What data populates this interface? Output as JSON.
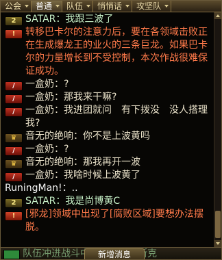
{
  "tabs": [
    {
      "label": "公会",
      "active": false
    },
    {
      "label": "普通",
      "active": true
    },
    {
      "label": "队伍",
      "active": false
    },
    {
      "label": "悄悄话",
      "active": false
    },
    {
      "label": "攻坚队",
      "active": false
    }
  ],
  "messages": [
    {
      "channel": "team",
      "badge": "2",
      "text": "SATAR：我跟三波了"
    },
    {
      "channel": "system",
      "badge": "!",
      "text": "转移巴卡尔的注意力后，要在各领域击败正在生成爆龙王的业火的三条巨龙。如果巴卡尔的力量增长到不受控制，本次作战很难保证成功。"
    },
    {
      "channel": "world",
      "badge": "/",
      "text": "一盒奶：?"
    },
    {
      "channel": "world",
      "badge": "/",
      "text": "一盒奶：那我来干嘛?"
    },
    {
      "channel": "world",
      "badge": "/",
      "text": "一盒奶：我进团就问　有下拨没　没人搭理我?"
    },
    {
      "channel": "crown",
      "badge": "♛",
      "text": "音无的绝响：你不是上波黄吗"
    },
    {
      "channel": "world",
      "badge": "/",
      "text": "一盒奶：?"
    },
    {
      "channel": "crown",
      "badge": "♛",
      "text": "音无的绝响：那我再开一波"
    },
    {
      "channel": "world",
      "badge": "/",
      "text": "一盒奶：我啥时候上波黄了"
    },
    {
      "channel": "local",
      "badge": "",
      "text": "RuningMan!：.."
    },
    {
      "channel": "team",
      "badge": "2",
      "text": "SATAR：我是尚博黄C"
    },
    {
      "channel": "system",
      "badge": "!",
      "text": "[邪龙]领域中出现了[腐败区域]要想办法摆脱。"
    }
  ],
  "bottom": {
    "preview_text": "队伍冲进战斗中……龙贝里斯克",
    "new_message_label": "新增消息"
  }
}
